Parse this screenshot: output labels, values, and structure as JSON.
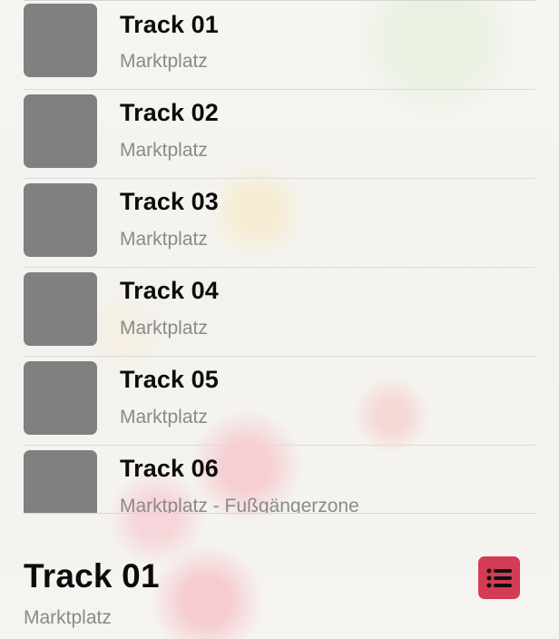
{
  "tracks": [
    {
      "title": "Track 01",
      "subtitle": "Marktplatz"
    },
    {
      "title": "Track 02",
      "subtitle": "Marktplatz"
    },
    {
      "title": "Track 03",
      "subtitle": "Marktplatz"
    },
    {
      "title": "Track 04",
      "subtitle": "Marktplatz"
    },
    {
      "title": "Track 05",
      "subtitle": "Marktplatz"
    },
    {
      "title": "Track 06",
      "subtitle": "Marktplatz - Fußgängerzone"
    }
  ],
  "now_playing": {
    "title": "Track 01",
    "subtitle": "Marktplatz"
  },
  "icons": {
    "list_button": "list-icon"
  },
  "colors": {
    "accent": "#d43b55",
    "artwork_placeholder": "#808080",
    "secondary_text": "#8a8a8a"
  }
}
